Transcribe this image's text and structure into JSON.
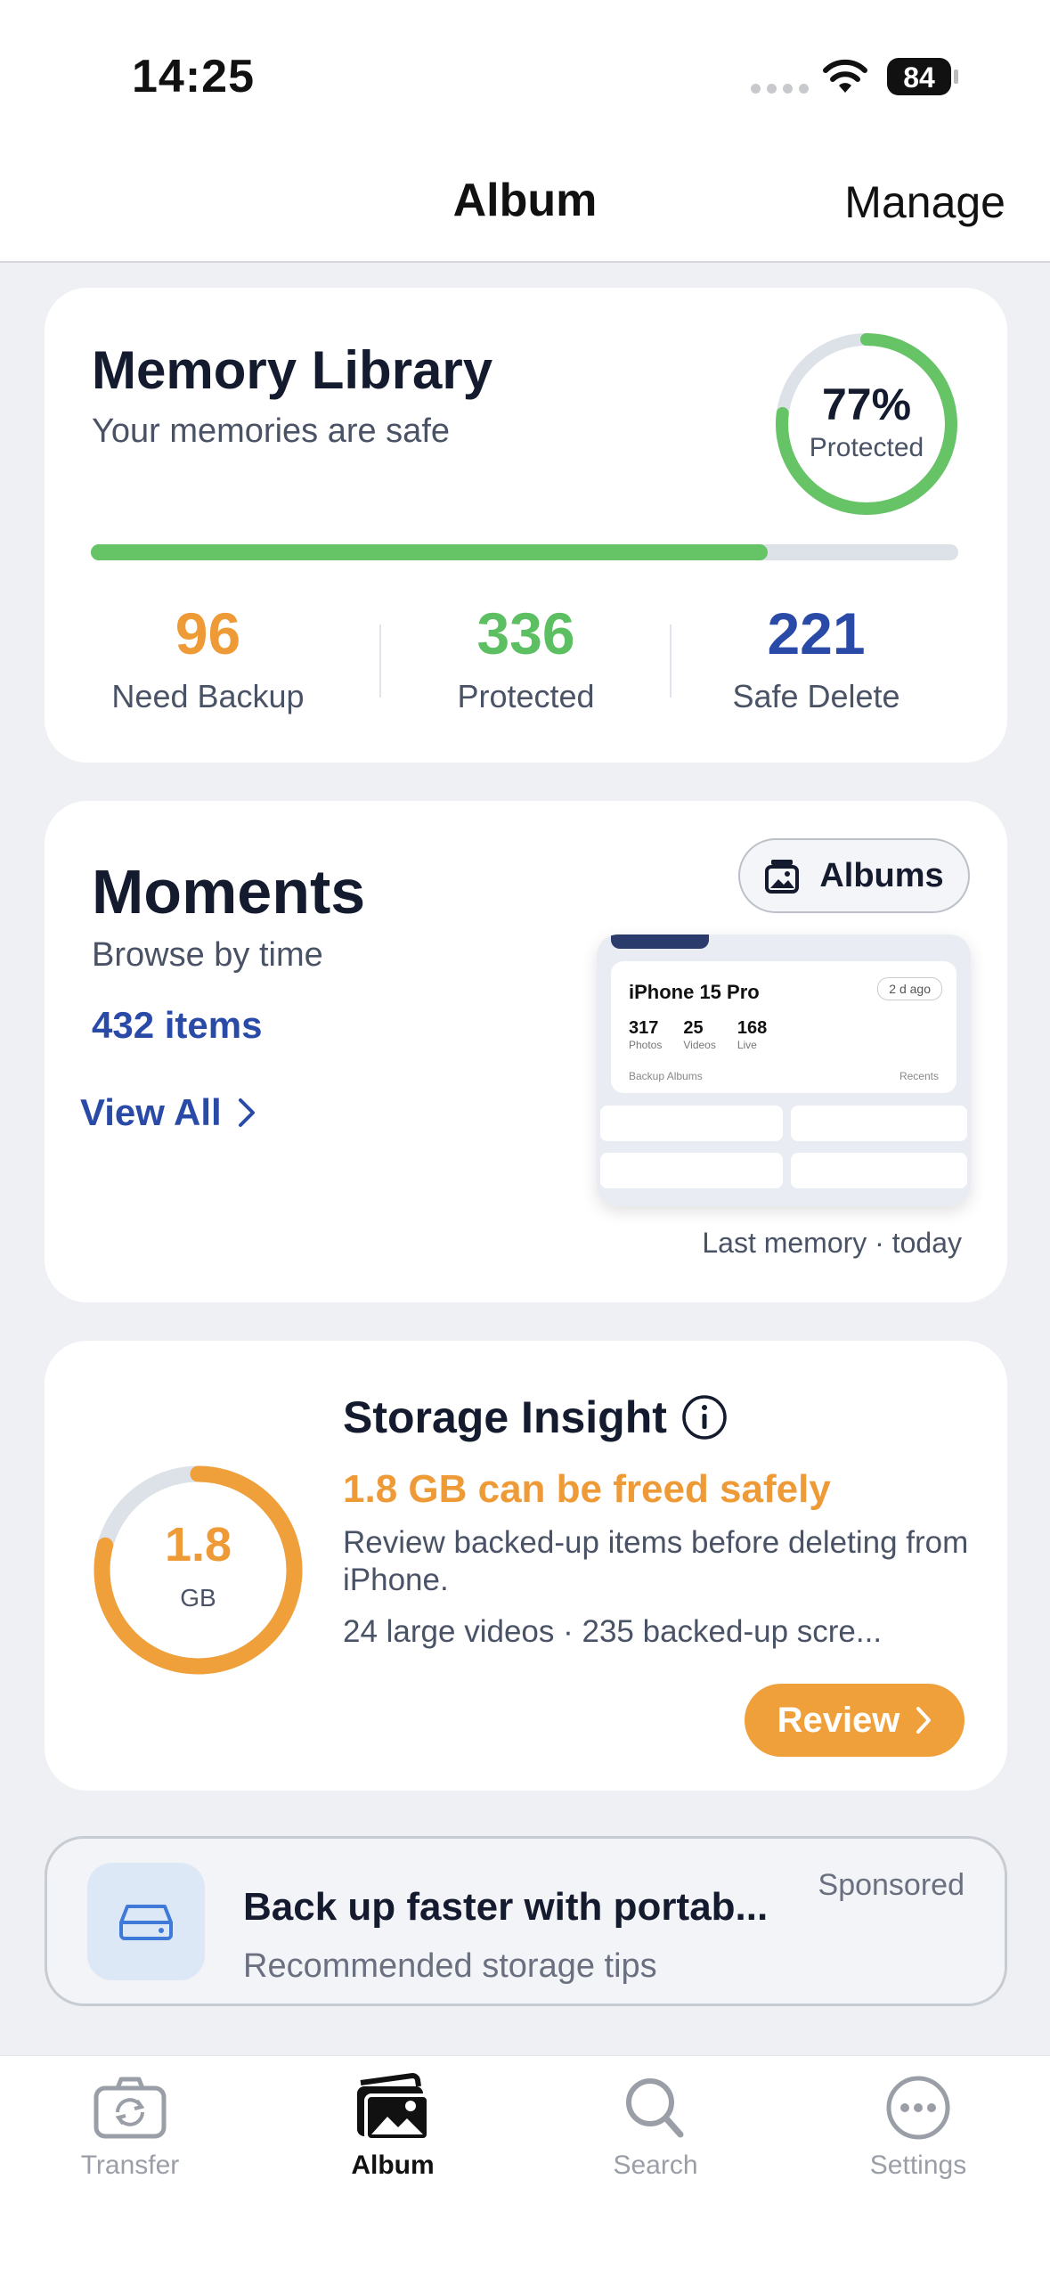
{
  "status_bar": {
    "time": "14:25",
    "battery": "84"
  },
  "nav": {
    "title": "Album",
    "manage": "Manage"
  },
  "memory_library": {
    "title": "Memory Library",
    "subtitle": "Your memories are safe",
    "ring_percent": "77%",
    "ring_label": "Protected",
    "progress_fraction": 0.78,
    "stats": [
      {
        "value": "96",
        "label": "Need Backup",
        "color": "#ee9a36"
      },
      {
        "value": "336",
        "label": "Protected",
        "color": "#5cbf62"
      },
      {
        "value": "221",
        "label": "Safe Delete",
        "color": "#2a4aa8"
      }
    ]
  },
  "moments": {
    "title": "Moments",
    "subtitle": "Browse by time",
    "count": "432 items",
    "view_all": "View All",
    "albums_button": "Albums",
    "caption": "Last memory · today",
    "thumbnail": {
      "device": "iPhone 15 Pro",
      "ago": "2 d ago",
      "counts": [
        {
          "value": "317",
          "label": "Photos"
        },
        {
          "value": "25",
          "label": "Videos"
        },
        {
          "value": "168",
          "label": "Live"
        }
      ],
      "footer_left": "Backup Albums",
      "footer_right": "Recents"
    }
  },
  "storage": {
    "title": "Storage Insight",
    "donut_value": "1.8",
    "donut_unit": "GB",
    "headline": "1.8 GB can be freed safely",
    "description": "Review backed-up items before deleting from iPhone.",
    "detail": "24 large videos · 235 backed-up scre...",
    "review_button": "Review"
  },
  "sponsored": {
    "title": "Back up faster with portab...",
    "subtitle": "Recommended storage tips",
    "tag": "Sponsored"
  },
  "tabs": [
    {
      "label": "Transfer",
      "icon": "camera-rotate-icon"
    },
    {
      "label": "Album",
      "icon": "photo-album-icon"
    },
    {
      "label": "Search",
      "icon": "search-icon"
    },
    {
      "label": "Settings",
      "icon": "ellipsis-circle-icon"
    }
  ],
  "colors": {
    "orange": "#ee9a36",
    "green": "#5cbf62",
    "blue": "#2a4aa8"
  }
}
